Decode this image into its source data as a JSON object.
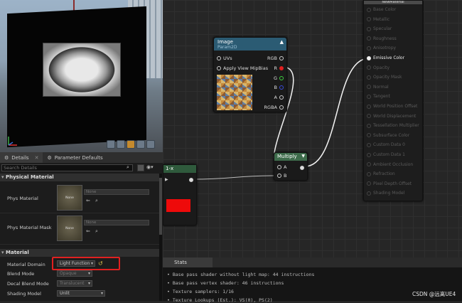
{
  "details_tabs": [
    {
      "label": "Details"
    },
    {
      "label": "Parameter Defaults"
    }
  ],
  "search": {
    "placeholder": "Search Details"
  },
  "sections": {
    "physical_material": "Physical Material",
    "material": "Material"
  },
  "phys_rows": [
    {
      "label": "Phys Material",
      "thumb": "None",
      "dropdown": "None"
    },
    {
      "label": "Phys Material Mask",
      "thumb": "None",
      "dropdown": "None"
    }
  ],
  "material_rows": [
    {
      "label": "Material Domain",
      "value": "Light Function"
    },
    {
      "label": "Blend Mode",
      "value": "Opaque"
    },
    {
      "label": "Decal Blend Mode",
      "value": "Translucent"
    },
    {
      "label": "Shading Model",
      "value": "Unlit"
    }
  ],
  "image_node": {
    "title": "Image",
    "subtitle": "Param2D",
    "inputs": [
      "UVs",
      "Apply View MipBias"
    ],
    "outputs": [
      "RGB",
      "R",
      "G",
      "B",
      "A",
      "RGBA"
    ]
  },
  "multiply_node": {
    "title": "Multiply",
    "inputs": [
      "A",
      "B"
    ]
  },
  "const_node": {
    "title": "1-x"
  },
  "material_node": {
    "title": "NewMaterial",
    "pins": [
      "Base Color",
      "Metallic",
      "Specular",
      "Roughness",
      "Anisotropy",
      "Emissive Color",
      "Opacity",
      "Opacity Mask",
      "Normal",
      "Tangent",
      "World Position Offset",
      "World Displacement",
      "Tessellation Multiplier",
      "Subsurface Color",
      "Custom Data 0",
      "Custom Data 1",
      "Ambient Occlusion",
      "Refraction",
      "Pixel Depth Offset",
      "Shading Model"
    ],
    "active_pin": "Emissive Color"
  },
  "stats": {
    "tab": "Stats",
    "lines": [
      "Base pass shader without light map: 44 instructions",
      "Base pass vertex shader: 46 instructions",
      "Texture samplers: 1/16",
      "Texture Lookups (Est.): VS(0), PS(2)"
    ]
  },
  "watermark": "CSDN @远离UE4",
  "colors": {
    "accent_red": "#e02020",
    "node_header": "#2b5b73",
    "multiply_header": "#3e6b4b"
  }
}
